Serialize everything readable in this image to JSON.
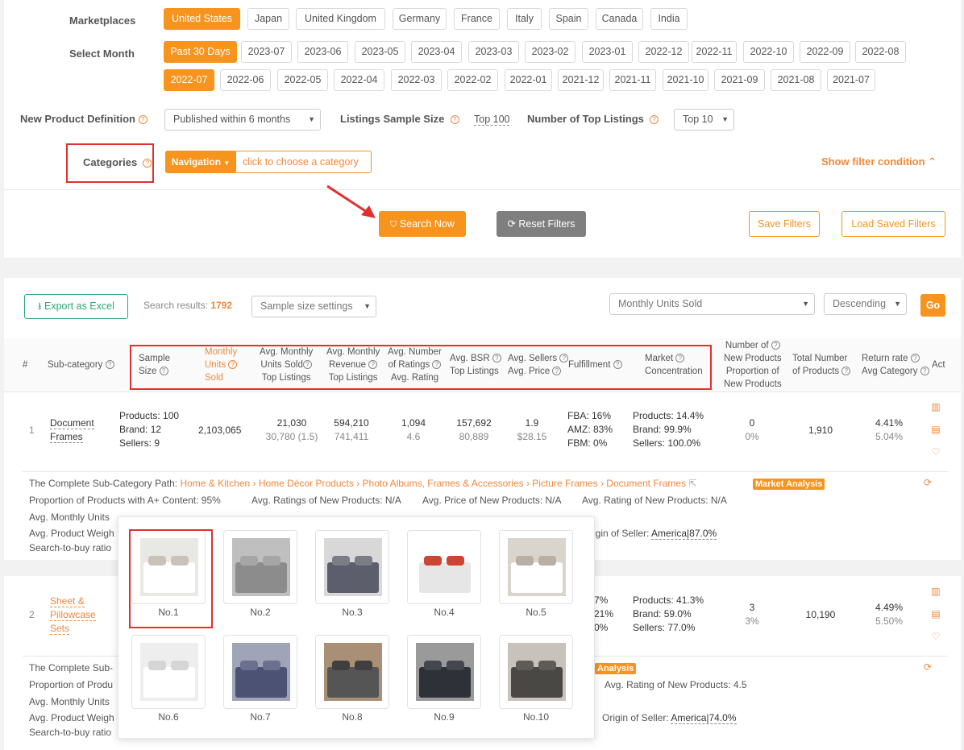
{
  "filters": {
    "marketplaces_label": "Marketplaces",
    "marketplaces": [
      "United States",
      "Japan",
      "United Kingdom",
      "Germany",
      "France",
      "Italy",
      "Spain",
      "Canada",
      "India"
    ],
    "month_label": "Select Month",
    "months_row1": [
      "Past 30 Days",
      "2023-07",
      "2023-06",
      "2023-05",
      "2023-04",
      "2023-03",
      "2023-02",
      "2023-01",
      "2022-12",
      "2022-11",
      "2022-10",
      "2022-09",
      "2022-08"
    ],
    "months_row2": [
      "2022-07",
      "2022-06",
      "2022-05",
      "2022-04",
      "2022-03",
      "2022-02",
      "2022-01",
      "2021-12",
      "2021-11",
      "2021-10",
      "2021-09",
      "2021-08",
      "2021-07"
    ],
    "npd_label": "New Product Definition",
    "npd_value": "Published within 6 months",
    "sample_label": "Listings Sample Size",
    "sample_value": "Top 100",
    "top_label": "Number of Top Listings",
    "top_value": "Top 10",
    "categories_label": "Categories",
    "nav_btn": "Navigation",
    "choose_category": "click to choose a category",
    "show_filter": "Show filter condition",
    "search_btn": "Search Now",
    "reset_btn": "Reset Filters",
    "save_btn": "Save Filters",
    "load_btn": "Load Saved Filters"
  },
  "results": {
    "export_btn": "Export as Excel",
    "search_results_label": "Search results:",
    "search_results_count": "1792",
    "sample_settings": "Sample size settings",
    "sort_field": "Monthly Units Sold",
    "sort_order": "Descending",
    "go_btn": "Go"
  },
  "headers": {
    "num": "#",
    "subcat": "Sub-category",
    "sample": [
      "Sample",
      "Size"
    ],
    "units": [
      "Monthly",
      "Units",
      "Sold"
    ],
    "avg_units": [
      "Avg. Monthly",
      "Units Sold",
      "Top Listings"
    ],
    "avg_rev": [
      "Avg. Monthly",
      "Revenue",
      "Top Listings"
    ],
    "ratings": [
      "Avg. Number",
      "of Ratings",
      "Avg. Rating"
    ],
    "bsr": [
      "Avg. BSR",
      "Top Listings"
    ],
    "sellers": [
      "Avg. Sellers",
      "Avg. Price"
    ],
    "fulfillment": "Fulfillment",
    "concentration": [
      "Market",
      "Concentration"
    ],
    "newprod": [
      "Number of",
      "New Products",
      "Proportion of",
      "New Products"
    ],
    "total": [
      "Total Number",
      "of Products"
    ],
    "return": [
      "Return rate",
      "Avg Category"
    ],
    "act": "Act"
  },
  "rows": [
    {
      "num": "1",
      "name": [
        "Document",
        "Frames"
      ],
      "sample": [
        "Products: 100",
        "Brand: 12",
        "Sellers: 9"
      ],
      "units": "2,103,065",
      "avg_units": "21,030",
      "avg_units_sub": "30,780 (1.5)",
      "avg_rev": "594,210",
      "avg_rev_sub": "741,411",
      "ratings": "1,094",
      "rating": "4.6",
      "bsr": "157,692",
      "bsr_sub": "80,889",
      "sellers": "1.9",
      "price": "$28.15",
      "fulfillment": [
        "FBA: 16%",
        "AMZ: 83%",
        "FBM: 0%"
      ],
      "concentration": [
        "Products: 14.4%",
        "Brand: 99.9%",
        "Sellers: 100.0%"
      ],
      "newprod": "0",
      "newprod_pct": "0%",
      "total": "1,910",
      "return": "4.41%",
      "return_avg": "5.04%",
      "path_label": "The Complete Sub-Category Path:",
      "path": "Home & Kitchen › Home Décor Products › Photo Albums, Frames & Accessories › Picture Frames › Document Frames",
      "market_analysis": "Market Analysis",
      "aplus": "Proportion of Products with A+ Content: 95%",
      "ratings_new": "Avg. Ratings of New Products: N/A",
      "price_new": "Avg. Price of New Products: N/A",
      "rating_new": "Avg. Rating of New Products: N/A",
      "monthly_units_trunc": "Avg. Monthly Units",
      "weight_trunc": "Avg. Product Weigh",
      "origin_label": "igin of Seller:",
      "origin_value": "America|87.0%",
      "s2b_trunc": "Search-to-buy ratio"
    },
    {
      "num": "2",
      "name": [
        "Sheet &",
        "Pillowcase",
        "Sets"
      ],
      "fulfillment_partial": [
        "7%",
        "21%",
        "0%"
      ],
      "concentration": [
        "Products: 41.3%",
        "Brand: 59.0%",
        "Sellers: 77.0%"
      ],
      "newprod": "3",
      "newprod_pct": "3%",
      "total": "10,190",
      "return": "4.49%",
      "return_avg": "5.50%",
      "path_label": "The Complete Sub-",
      "market_analysis_partial": "Analysis",
      "aplus_trunc": "Proportion of Produ",
      "rating_new": "Avg. Rating of New Products: 4.5",
      "monthly_units_trunc": "Avg. Monthly Units",
      "weight_trunc": "Avg. Product Weigh",
      "origin_label": "Origin of Seller:",
      "origin_value": "America|74.0%",
      "s2b_trunc": "Search-to-buy ratio"
    }
  ],
  "popup": {
    "items": [
      "No.1",
      "No.2",
      "No.3",
      "No.4",
      "No.5",
      "No.6",
      "No.7",
      "No.8",
      "No.9",
      "No.10"
    ]
  },
  "colors": {
    "accent": "#f7941d",
    "teal": "#2aa876",
    "red": "#e03030",
    "gray_btn": "#7f7f7f"
  }
}
